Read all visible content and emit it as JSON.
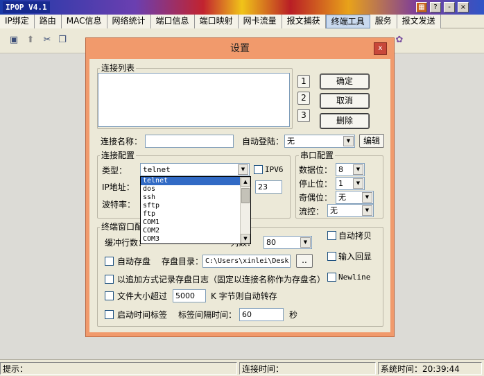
{
  "window": {
    "title": "IPOP V4.1",
    "buttons": [
      "?",
      "-",
      "×"
    ]
  },
  "menu": {
    "tabs": [
      "IP绑定",
      "路由",
      "MAC信息",
      "网络统计",
      "端口信息",
      "端口映射",
      "网卡流量",
      "报文捕获",
      "终端工具",
      "服务",
      "报文发送"
    ],
    "active_index": 8
  },
  "toolbar": {
    "icons": [
      "network-icon",
      "upload-icon",
      "cut-icon",
      "copy-icon"
    ]
  },
  "dialog": {
    "title": "设置",
    "close_glyph": "x",
    "connection_list": {
      "label": "连接列表",
      "number_buttons": [
        "1",
        "2",
        "3"
      ]
    },
    "buttons": {
      "ok": "确定",
      "cancel": "取消",
      "delete": "删除",
      "edit": "编辑",
      "browse": ".."
    },
    "connection_name": {
      "label": "连接名称：",
      "value": ""
    },
    "auto_login": {
      "label": "自动登陆：",
      "value": "无"
    },
    "connection_config": {
      "label": "连接配置",
      "type_label": "类型：",
      "type_value": "telnet",
      "ipv6_label": "IPV6",
      "ip_label": "IP地址：",
      "port_value": "23",
      "baud_label": "波特率："
    },
    "type_dropdown": {
      "options": [
        "telnet",
        "dos",
        "ssh",
        "sftp",
        "ftp",
        "COM1",
        "COM2",
        "COM3"
      ],
      "selected_index": 0
    },
    "serial_config": {
      "label": "串口配置",
      "data_bits_label": "数据位：",
      "data_bits": "8",
      "stop_bits_label": "停止位：",
      "stop_bits": "1",
      "parity_label": "奇偶位：",
      "parity": "无",
      "flow_label": "流控：",
      "flow": "无"
    },
    "terminal_config": {
      "label": "终端窗口配",
      "buffer_label": "缓冲行数：",
      "columns_label": "列数：",
      "columns_value": "80",
      "auto_copy_label": "自动拷贝",
      "echo_label": "输入回显",
      "newline_label": "Newline",
      "auto_save_label": "自动存盘",
      "save_dir_label": "存盘目录：",
      "save_dir_value": "C:\\Users\\xinlei\\Desk",
      "append_log_label": "以追加方式记录存盘日志（固定以连接名称作为存盘名）",
      "file_size_label": "文件大小超过",
      "file_size_value": "5000",
      "file_size_suffix": "K 字节则自动转存",
      "timestamp_label": "启动时间标签",
      "interval_label": "标签间隔时间：",
      "interval_value": "60",
      "interval_unit": "秒"
    }
  },
  "status": {
    "hint": "提示：",
    "connect_time": "连接时间：",
    "system_time": "系统时间：20:39:44"
  }
}
